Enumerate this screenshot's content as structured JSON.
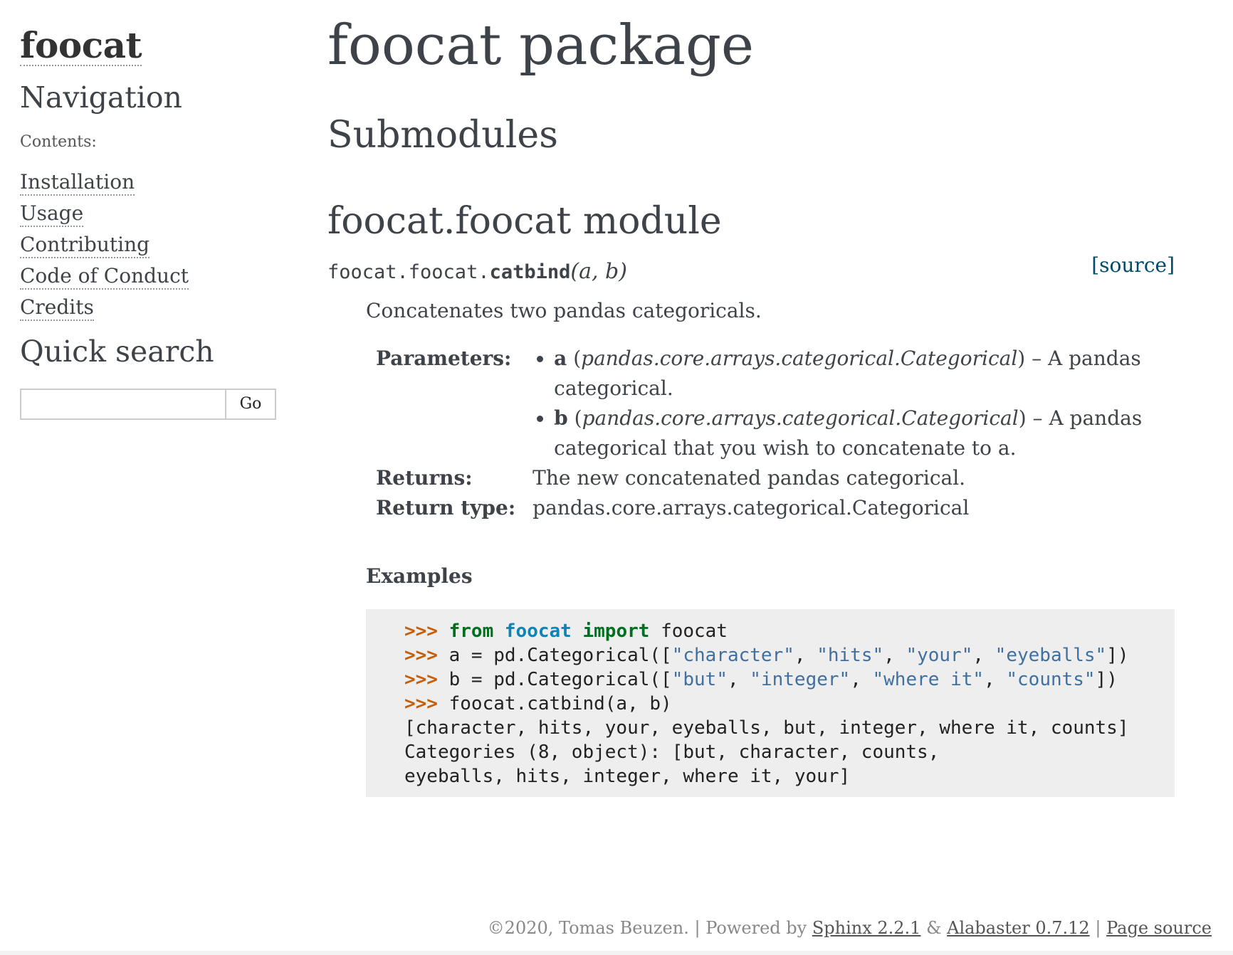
{
  "sidebar": {
    "logo": "foocat",
    "nav_title": "Navigation",
    "caption": "Contents:",
    "items": [
      "Installation",
      "Usage",
      "Contributing",
      "Code of Conduct",
      "Credits"
    ],
    "search_title": "Quick search",
    "search_value": "",
    "search_button": "Go"
  },
  "main": {
    "title": "foocat package",
    "submodules_title": "Submodules",
    "module_title": "foocat.foocat module",
    "signature": {
      "prefix": "foocat.foocat.",
      "name": "catbind",
      "params": "(a, b)",
      "source_link": "[source]"
    },
    "summary": "Concatenates two pandas categoricals.",
    "fields": {
      "params_label": "Parameters:",
      "param_a_name": "a",
      "param_a_type": "pandas.core.arrays.categorical.Categorical",
      "param_a_desc": "A pandas categorical.",
      "param_b_name": "b",
      "param_b_type": "pandas.core.arrays.categorical.Categorical",
      "param_b_desc": "A pandas categorical that you wish to concatenate to a.",
      "returns_label": "Returns:",
      "returns_value": "The new concatenated pandas categorical.",
      "rtype_label": "Return type:",
      "rtype_value": "pandas.core.arrays.categorical.Categorical"
    },
    "examples_title": "Examples",
    "code": {
      "prompt": ">>>",
      "l1_kw_from": "from",
      "l1_mod": "foocat",
      "l1_kw_import": "import",
      "l1_rest": "foocat",
      "l2_pre": "a = pd.Categorical([",
      "l2_s1": "\"character\"",
      "l2_s2": "\"hits\"",
      "l2_s3": "\"your\"",
      "l2_s4": "\"eyeballs\"",
      "l2_post": "])",
      "l3_pre": "b = pd.Categorical([",
      "l3_s1": "\"but\"",
      "l3_s2": "\"integer\"",
      "l3_s3": "\"where it\"",
      "l3_s4": "\"counts\"",
      "l3_post": "])",
      "l4": "foocat.catbind(a, b)",
      "out1": "[character, hits, your, eyeballs, but, integer, where it, counts]",
      "out2": "Categories (8, object): [but, character, counts,",
      "out3": "eyeballs, hits, integer, where it, your]"
    }
  },
  "footer": {
    "copyright": "©2020, Tomas Beuzen.",
    "sep1": "|",
    "powered_by": "Powered by",
    "sphinx_link": "Sphinx 2.2.1",
    "amp": "&",
    "alabaster_link": "Alabaster 0.7.12",
    "sep2": "|",
    "page_source_link": "Page source"
  },
  "colors": {
    "text": "#3e4349",
    "link_source": "#004b6b",
    "code_bg": "#eeeeee",
    "prompt": "#c65d09",
    "keyword": "#007020",
    "namespace": "#0e84b5",
    "string": "#4070a0"
  }
}
